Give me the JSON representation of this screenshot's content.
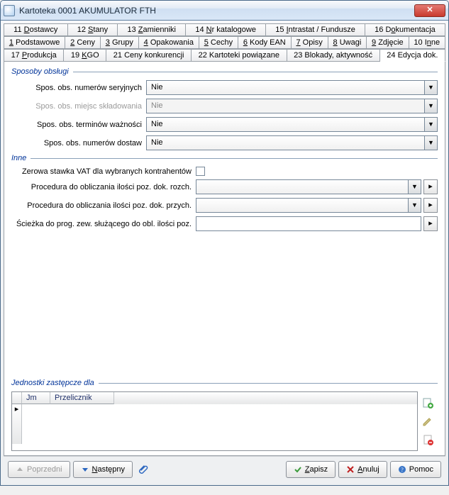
{
  "window": {
    "title": "Kartoteka  0001  AKUMULATOR FTH"
  },
  "tabs": {
    "row1": [
      {
        "pre": "11 ",
        "ul": "D",
        "post": "ostawcy"
      },
      {
        "pre": "12 ",
        "ul": "S",
        "post": "tany"
      },
      {
        "pre": "13 ",
        "ul": "Z",
        "post": "amienniki"
      },
      {
        "pre": "14 ",
        "ul": "N",
        "post": "r katalogowe"
      },
      {
        "pre": "15 ",
        "ul": "I",
        "post": "ntrastat / Fundusze"
      },
      {
        "pre": "16 D",
        "ul": "o",
        "post": "kumentacja"
      }
    ],
    "row2": [
      {
        "pre": "",
        "ul": "1",
        "post": " Podstawowe"
      },
      {
        "pre": "",
        "ul": "2",
        "post": " Ceny"
      },
      {
        "pre": "",
        "ul": "3",
        "post": " Grupy"
      },
      {
        "pre": "",
        "ul": "4",
        "post": " Opakowania"
      },
      {
        "pre": "",
        "ul": "5",
        "post": " Cechy"
      },
      {
        "pre": "",
        "ul": "6",
        "post": " Kody EAN"
      },
      {
        "pre": "",
        "ul": "7",
        "post": " Opisy"
      },
      {
        "pre": "",
        "ul": "8",
        "post": " Uwagi"
      },
      {
        "pre": "",
        "ul": "9",
        "post": " Zdjęcie"
      },
      {
        "pre": "10 I",
        "ul": "n",
        "post": "ne"
      }
    ],
    "row3": [
      {
        "pre": "17 ",
        "ul": "P",
        "post": "rodukcja"
      },
      {
        "pre": "19 ",
        "ul": "K",
        "post": "GO"
      },
      {
        "pre": "21 Ceny konkurencji",
        "ul": "",
        "post": ""
      },
      {
        "pre": "22 Kartoteki powiązane",
        "ul": "",
        "post": ""
      },
      {
        "pre": "23 Blokady, aktywność",
        "ul": "",
        "post": ""
      },
      {
        "pre": "24 Edycja dok.",
        "ul": "",
        "post": "",
        "active": true
      }
    ]
  },
  "sposoby": {
    "legend": "Sposoby obsługi",
    "row1": {
      "label": "Spos. obs. numerów seryjnych",
      "value": "Nie"
    },
    "row2": {
      "label": "Spos. obs. miejsc składowania",
      "value": "Nie",
      "disabled": true
    },
    "row3": {
      "label": "Spos. obs. terminów ważności",
      "value": "Nie"
    },
    "row4": {
      "label": "Spos. obs. numerów dostaw",
      "value": "Nie"
    }
  },
  "inne": {
    "legend": "Inne",
    "chk_label": "Zerowa stawka VAT dla wybranych kontrahentów",
    "r1": {
      "label": "Procedura do obliczania ilości poz. dok. rozch.",
      "value": ""
    },
    "r2": {
      "label": "Procedura do obliczania ilości poz. dok. przych.",
      "value": ""
    },
    "r3": {
      "label": "Ścieżka do prog. zew. służącego do obl. ilości poz.",
      "value": ""
    }
  },
  "jednostki": {
    "legend": "Jednostki zastępcze dla",
    "col1": "Jm",
    "col2": "Przelicznik"
  },
  "footer": {
    "prev": "Poprzedni",
    "next": "astępny",
    "next_ul": "N",
    "save": "apisz",
    "save_ul": "Z",
    "cancel": "nuluj",
    "cancel_ul": "A",
    "help": "Pomoc"
  }
}
